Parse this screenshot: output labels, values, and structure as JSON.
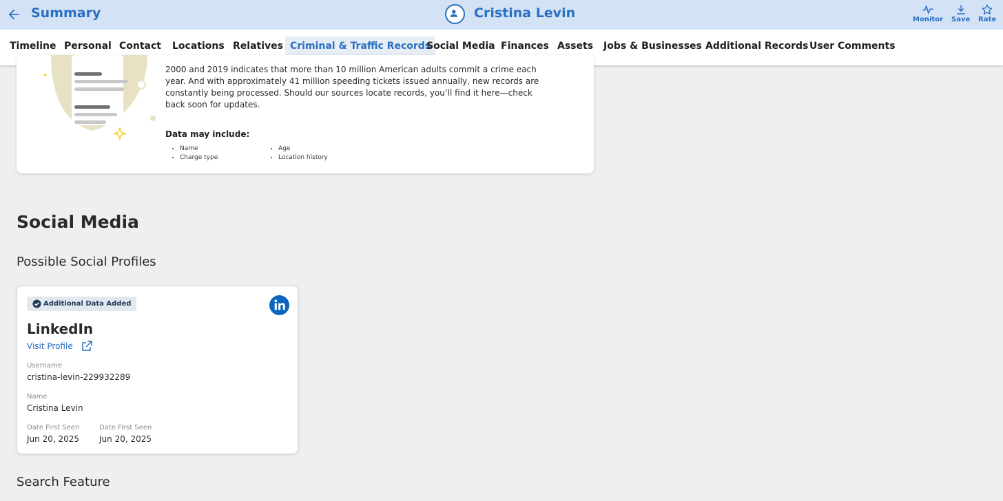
{
  "header": {
    "back_label": "Summary",
    "person_name": "Cristina Levin",
    "actions": {
      "monitor": "Monitor",
      "save": "Save",
      "rate": "Rate"
    }
  },
  "tabs": [
    {
      "label": "Timeline"
    },
    {
      "label": "Personal"
    },
    {
      "label": "Contact"
    },
    {
      "label": "Locations"
    },
    {
      "label": "Relatives"
    },
    {
      "label": "Criminal & Traffic Records",
      "active": true
    },
    {
      "label": "Social Media"
    },
    {
      "label": "Finances"
    },
    {
      "label": "Assets"
    },
    {
      "label": "Jobs & Businesses"
    },
    {
      "label": "Additional Records"
    },
    {
      "label": "User Comments"
    }
  ],
  "criminal": {
    "paragraph": "2000 and 2019 indicates that more than 10 million American adults commit a crime each year. And with approximately 41 million speeding tickets issued annually, new records are constantly being processed. Should our sources locate records, you’ll find it here—check back soon for updates.",
    "data_may_include": "Data may include:",
    "list_left": [
      "Name",
      "Charge type"
    ],
    "list_right": [
      "Age",
      "Location history"
    ]
  },
  "social": {
    "section_title": "Social Media",
    "subsection_title": "Possible Social Profiles",
    "card": {
      "badge": "Additional Data Added",
      "network": "LinkedIn",
      "visit_label": "Visit Profile",
      "username_label": "Username",
      "username": "cristina-levin-229932289",
      "name_label": "Name",
      "name": "Cristina Levin",
      "date1_label": "Date First Seen",
      "date1": "Jun 20, 2025",
      "date2_label": "Date First Seen",
      "date2": "Jun 20, 2025"
    }
  },
  "search_feature": {
    "title": "Search Feature"
  },
  "colors": {
    "accent": "#2a6fc2",
    "header_bg": "#d3e3f5",
    "linkedin": "#0a66c2"
  }
}
